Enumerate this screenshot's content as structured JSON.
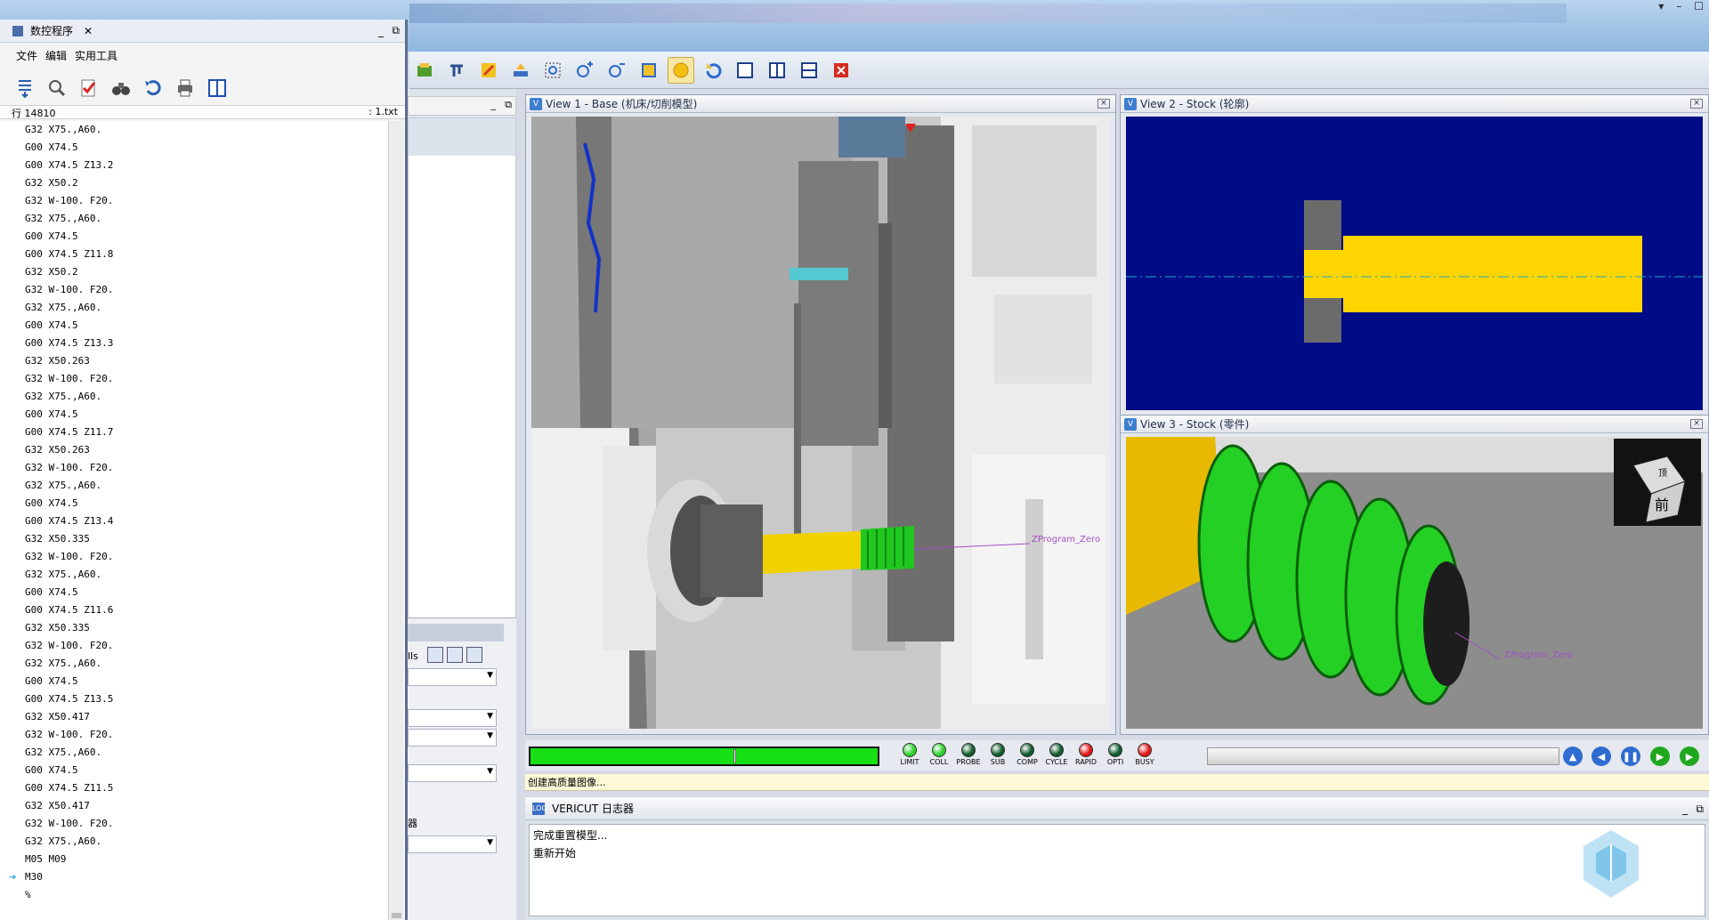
{
  "app": {
    "window_controls": [
      "▾",
      "–",
      "☐"
    ]
  },
  "nc_panel": {
    "title": "数控程序",
    "menu": [
      "文件",
      "编辑",
      "实用工具"
    ],
    "status_line": "行 14810",
    "status_file": ": 1.txt",
    "lines": [
      "G32 X75.,A60.",
      "G00 X74.5",
      "G00 X74.5 Z13.2",
      "G32 X50.2",
      "G32 W-100. F20.",
      "G32 X75.,A60.",
      "G00 X74.5",
      "G00 X74.5 Z11.8",
      "G32 X50.2",
      "G32 W-100. F20.",
      "G32 X75.,A60.",
      "G00 X74.5",
      "G00 X74.5 Z13.3",
      "G32 X50.263",
      "G32 W-100. F20.",
      "G32 X75.,A60.",
      "G00 X74.5",
      "G00 X74.5 Z11.7",
      "G32 X50.263",
      "G32 W-100. F20.",
      "G32 X75.,A60.",
      "G00 X74.5",
      "G00 X74.5 Z13.4",
      "G32 X50.335",
      "G32 W-100. F20.",
      "G32 X75.,A60.",
      "G00 X74.5",
      "G00 X74.5 Z11.6",
      "G32 X50.335",
      "G32 W-100. F20.",
      "G32 X75.,A60.",
      "G00 X74.5",
      "G00 X74.5 Z13.5",
      "G32 X50.417",
      "G32 W-100. F20.",
      "G32 X75.,A60.",
      "G00 X74.5",
      "G00 X74.5 Z11.5",
      "G32 X50.417",
      "G32 W-100. F20.",
      "G32 X75.,A60.",
      "M05 M09",
      "M30",
      "%"
    ],
    "current_line": "M30"
  },
  "mid_panel": {
    "tab_fragment": "lls",
    "side_fragment": "器"
  },
  "views": {
    "view1_title": "View 1 - Base (机床/切削模型)",
    "view2_title": "View 2 - Stock (轮廓)",
    "view3_title": "View 3 - Stock (零件)",
    "program_zero_label": "ZProgram_Zero",
    "cube_label": "前",
    "cube_top_label": "顶"
  },
  "controls": {
    "progress": 1.0,
    "leds": [
      {
        "label": "LIMIT",
        "color": "#2bd12b"
      },
      {
        "label": "COLL",
        "color": "#2bd12b"
      },
      {
        "label": "PROBE",
        "color": "#0e5a2b"
      },
      {
        "label": "SUB",
        "color": "#0e5a2b"
      },
      {
        "label": "COMP",
        "color": "#0e5a2b"
      },
      {
        "label": "CYCLE",
        "color": "#0e5a2b"
      },
      {
        "label": "RAPID",
        "color": "#e01616"
      },
      {
        "label": "OPTI",
        "color": "#0e5a2b"
      },
      {
        "label": "BUSY",
        "color": "#e01616"
      }
    ]
  },
  "status_message": "创建高质量图像...",
  "logger": {
    "title": "VERICUT 日志器",
    "entries": [
      "完成重置模型...",
      "重新开始"
    ]
  }
}
